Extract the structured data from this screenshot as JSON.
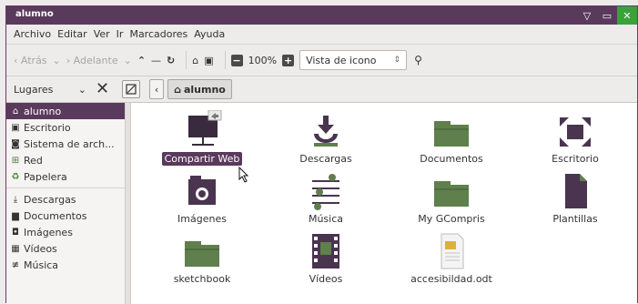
{
  "window": {
    "title": "alumno"
  },
  "menu": [
    "Archivo",
    "Editar",
    "Ver",
    "Ir",
    "Marcadores",
    "Ayuda"
  ],
  "toolbar": {
    "back": "‹ Atrás",
    "forward": "› Adelante",
    "zoom": "100%",
    "view": "Vista de icono"
  },
  "location": {
    "places_label": "Lugares",
    "crumb": "alumno"
  },
  "sidebar": [
    {
      "label": "alumno",
      "icon": "home-icon",
      "selected": true
    },
    {
      "label": "Escritorio",
      "icon": "desktop-icon"
    },
    {
      "label": "Sistema de arch...",
      "icon": "filesystem-icon"
    },
    {
      "label": "Red",
      "icon": "network-icon"
    },
    {
      "label": "Papelera",
      "icon": "trash-icon"
    },
    {
      "label": "Descargas",
      "icon": "download-icon"
    },
    {
      "label": "Documentos",
      "icon": "folder-icon"
    },
    {
      "label": "Imágenes",
      "icon": "camera-icon"
    },
    {
      "label": "Vídeos",
      "icon": "film-icon"
    },
    {
      "label": "Música",
      "icon": "music-icon"
    }
  ],
  "files": [
    {
      "label": "Compartir Web",
      "icon": "public-folder-icon",
      "selected": true
    },
    {
      "label": "Descargas",
      "icon": "download-folder-icon"
    },
    {
      "label": "Documentos",
      "icon": "folder-icon"
    },
    {
      "label": "Escritorio",
      "icon": "desktop-folder-icon"
    },
    {
      "label": "Imágenes",
      "icon": "camera-folder-icon"
    },
    {
      "label": "Música",
      "icon": "music-folder-icon"
    },
    {
      "label": "My GCompris",
      "icon": "folder-icon"
    },
    {
      "label": "Plantillas",
      "icon": "template-icon"
    },
    {
      "label": "sketchbook",
      "icon": "folder-icon"
    },
    {
      "label": "Vídeos",
      "icon": "video-folder-icon"
    },
    {
      "label": "accesibildad.odt",
      "icon": "document-icon"
    }
  ],
  "colors": {
    "accent": "#5a3a5c",
    "folder": "#5f7f4c",
    "dark_icon": "#4a3450"
  }
}
